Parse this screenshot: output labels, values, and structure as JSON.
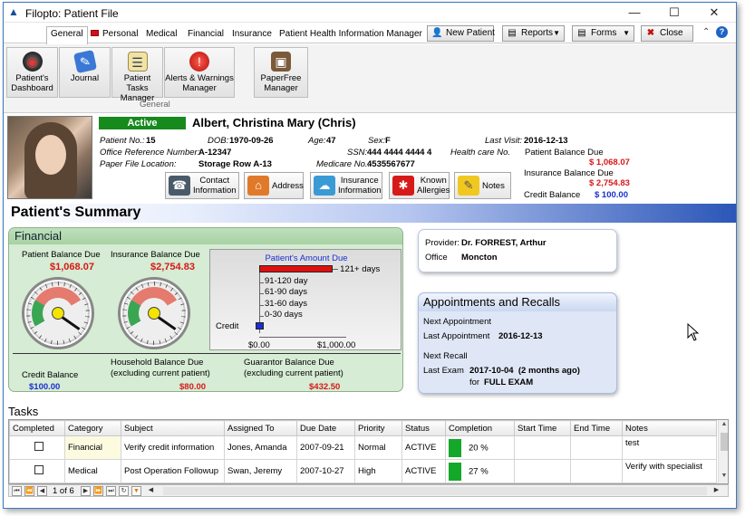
{
  "window": {
    "title": "Filopto: Patient File",
    "minimize": "—",
    "maximize": "☐",
    "close": "✕"
  },
  "tabs": [
    {
      "label": "General",
      "active": true
    },
    {
      "label": "Personal"
    },
    {
      "label": "Medical"
    },
    {
      "label": "Financial"
    },
    {
      "label": "Insurance"
    },
    {
      "label": "Patient Health Information Manager"
    }
  ],
  "toolbar": {
    "new_patient": "New Patient",
    "reports": "Reports",
    "forms": "Forms",
    "close": "Close"
  },
  "ribbon": {
    "buttons": [
      {
        "label": "Patient's Dashboard",
        "icon": "dashboard-icon"
      },
      {
        "label": "Journal",
        "icon": "journal-icon"
      },
      {
        "label": "Patient Tasks Manager",
        "icon": "tasks-icon"
      },
      {
        "label": "Alerts & Warnings Manager",
        "icon": "alert-icon"
      },
      {
        "label": "PaperFree Manager",
        "icon": "paperfree-icon"
      }
    ],
    "group": "General"
  },
  "patient": {
    "status": "Active",
    "name": "Albert, Christina Mary (Chris)",
    "patient_no_label": "Patient No.:",
    "patient_no": "15",
    "dob_label": "DOB:",
    "dob": "1970-09-26",
    "age_label": "Age:",
    "age": "47",
    "sex_label": "Sex:",
    "sex": "F",
    "last_visit_label": "Last Visit:",
    "last_visit": "2016-12-13",
    "office_ref_label": "Office Reference Number:",
    "office_ref": "A-12347",
    "ssn_label": "SSN:",
    "ssn": "444 4444 4444 4",
    "health_care_label": "Health care No.",
    "paper_file_label": "Paper File Location:",
    "paper_file": "Storage Row A-13",
    "medicare_label": "Medicare No.:",
    "medicare": "4535567677",
    "patient_balance_label": "Patient Balance Due",
    "patient_balance": "$ 1,068.07",
    "insurance_balance_label": "Insurance Balance Due",
    "insurance_balance": "$ 2,754.83",
    "credit_balance_label": "Credit Balance",
    "credit_balance": "$ 100.00"
  },
  "quick_buttons": [
    {
      "label": "Contact Information",
      "icon": "contact-icon"
    },
    {
      "label": "Address",
      "icon": "house-icon"
    },
    {
      "label": "Insurance Information",
      "icon": "insurance-icon"
    },
    {
      "label": "Known Allergies",
      "icon": "allergies-icon"
    },
    {
      "label": "Notes",
      "icon": "notes-icon"
    }
  ],
  "summary": {
    "title": "Patient's Summary"
  },
  "financial": {
    "title": "Financial",
    "patient_balance_label": "Patient Balance Due",
    "patient_balance": "$1,068.07",
    "insurance_balance_label": "Insurance Balance Due",
    "insurance_balance": "$2,754.83",
    "credit_balance_label": "Credit Balance",
    "credit_balance": "$100.00",
    "household_label1": "Household Balance Due",
    "household_label2": "(excluding current patient)",
    "household_balance": "$80.00",
    "guarantor_label1": "Guarantor Balance Due",
    "guarantor_label2": "(excluding current patient)",
    "guarantor_balance": "$432.50"
  },
  "chart_data": {
    "type": "bar",
    "title": "Patient's Amount Due",
    "categories": [
      "121+ days",
      "91-120 day",
      "61-90 days",
      "31-60 days",
      "0-30 days",
      "Credit"
    ],
    "values": [
      1068.07,
      0,
      0,
      0,
      0,
      100
    ],
    "colors": [
      "#e01010",
      "#1a2fd0"
    ],
    "xticks": [
      "$0.00",
      "$1,000.00"
    ],
    "xlim": [
      0,
      1000
    ]
  },
  "provider": {
    "provider_label": "Provider:",
    "provider": "Dr. FORREST, Arthur",
    "office_label": "Office",
    "office": "Moncton"
  },
  "appointments": {
    "title": "Appointments and Recalls",
    "next_appt_label": "Next Appointment",
    "last_appt_label": "Last Appointment",
    "last_appt": "2016-12-13",
    "next_recall_label": "Next Recall",
    "last_exam_label": "Last Exam",
    "last_exam": "2017-10-04  (2 months ago)",
    "for_label": "for",
    "for_value": "FULL EXAM"
  },
  "tasks": {
    "title": "Tasks",
    "columns": [
      "Completed",
      "Category",
      "Subject",
      "Assigned To",
      "Due Date",
      "Priority",
      "Status",
      "Completion",
      "Start Time",
      "End Time",
      "Notes"
    ],
    "rows": [
      {
        "category": "Financial",
        "subject": "Verify credit information",
        "assigned": "Jones, Amanda",
        "due": "2007-09-21",
        "priority": "Normal",
        "status": "ACTIVE",
        "completion": "20 %",
        "start": "",
        "end": "",
        "notes": "test"
      },
      {
        "category": "Medical",
        "subject": "Post Operation Followup",
        "assigned": "Swan, Jeremy",
        "due": "2007-10-27",
        "priority": "High",
        "status": "ACTIVE",
        "completion": "27 %",
        "start": "",
        "end": "",
        "notes": "Verify with specialist"
      }
    ],
    "page_info": "1 of 6"
  }
}
